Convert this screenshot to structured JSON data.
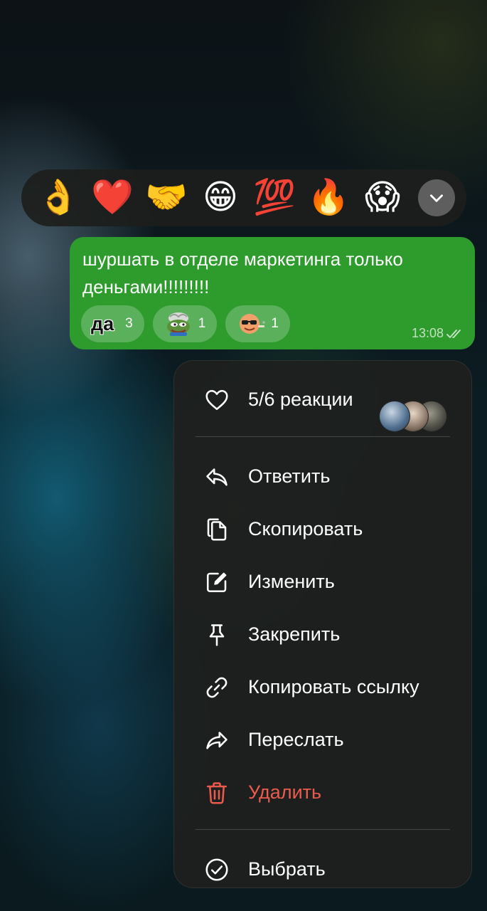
{
  "reactions": {
    "items": [
      {
        "name": "ok-hand",
        "glyph": "👌"
      },
      {
        "name": "red-heart",
        "glyph": "❤️"
      },
      {
        "name": "handshake",
        "glyph": "🤝"
      },
      {
        "name": "grinning",
        "glyph": "😁"
      },
      {
        "name": "hundred",
        "glyph": "💯"
      },
      {
        "name": "fire",
        "glyph": "🔥"
      },
      {
        "name": "screaming",
        "glyph": "😱"
      }
    ],
    "expand_icon": "chevron-down-icon"
  },
  "message": {
    "text": "шуршать в отделе маркетинга только деньгами!!!!!!!!!",
    "time": "13:08",
    "status_icon": "double-check-icon",
    "chips": [
      {
        "label": "да",
        "count": "3"
      },
      {
        "icon": "pepe-sticker",
        "count": "1"
      },
      {
        "icon": "cool-smiley-sticker",
        "count": "1"
      }
    ]
  },
  "menu": {
    "reactions_row": {
      "label": "5/6 реакции",
      "icon": "heart-outline-icon"
    },
    "items": [
      {
        "label": "Ответить",
        "icon": "reply-icon"
      },
      {
        "label": "Скопировать",
        "icon": "copy-icon"
      },
      {
        "label": "Изменить",
        "icon": "edit-icon"
      },
      {
        "label": "Закрепить",
        "icon": "pin-icon"
      },
      {
        "label": "Копировать ссылку",
        "icon": "link-icon"
      },
      {
        "label": "Переслать",
        "icon": "forward-icon"
      },
      {
        "label": "Удалить",
        "icon": "trash-icon",
        "color": "#eb5b4d"
      }
    ],
    "select": {
      "label": "Выбрать",
      "icon": "check-circle-icon"
    }
  },
  "colors": {
    "bubble": "#2e9c2d",
    "danger": "#eb5b4d",
    "menu_bg": "#1e201e"
  }
}
